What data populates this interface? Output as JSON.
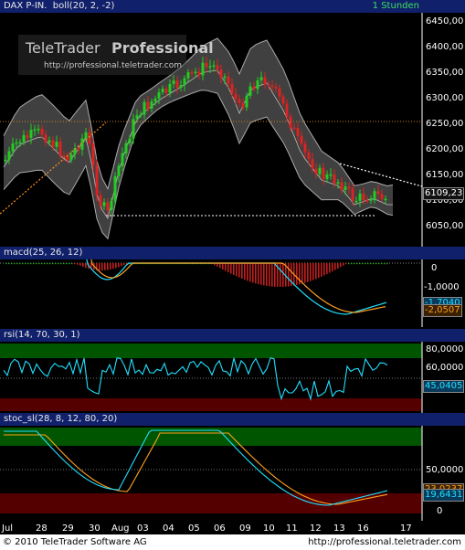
{
  "main": {
    "title": "DAX P-IN.",
    "indicator": "boll(20, 2, -2)",
    "interval": "1 Stunden",
    "watermark_brand": "TeleTrader",
    "watermark_product": "Professional",
    "watermark_url": "http://professional.teletrader.com",
    "price_label": "6109,23",
    "y_ticks": [
      "6450,00",
      "6400,00",
      "6350,00",
      "6300,00",
      "6250,00",
      "6200,00",
      "6150,00",
      "6100,00",
      "6050,00"
    ]
  },
  "macd": {
    "label": "macd(25, 26, 12)",
    "y_ticks": [
      "0",
      "-1,0000"
    ],
    "badge_signal": "-1,7040",
    "badge_macd": "-2,0507"
  },
  "rsi": {
    "label": "rsi(14, 70, 30, 1)",
    "y_ticks": [
      "80,0000",
      "60,0000",
      "45,0405"
    ],
    "badge": "45,0405"
  },
  "stoch": {
    "label": "stoc_sl(28, 8, 12, 80, 20)",
    "y_ticks": [
      "50,0000",
      "0"
    ],
    "badge_k": "19,6431",
    "badge_d": "23,0237"
  },
  "x_axis": [
    "Jul",
    "28",
    "29",
    "30",
    "Aug",
    "03",
    "04",
    "05",
    "06",
    "09",
    "10",
    "11",
    "12",
    "13",
    "16",
    "17"
  ],
  "footer": {
    "copyright": "© 2010 TeleTrader Software AG",
    "url": "http://professional.teletrader.com"
  },
  "colors": {
    "header_bg": "#10206a",
    "up_candle": "#22cc22",
    "down_candle": "#dd2222",
    "band_fill": "#555555",
    "macd_line": "#20e0ff",
    "signal_line": "#ffa020",
    "rsi_line": "#20e0ff",
    "overbought_zone": "#005500",
    "oversold_zone": "#550000"
  }
}
